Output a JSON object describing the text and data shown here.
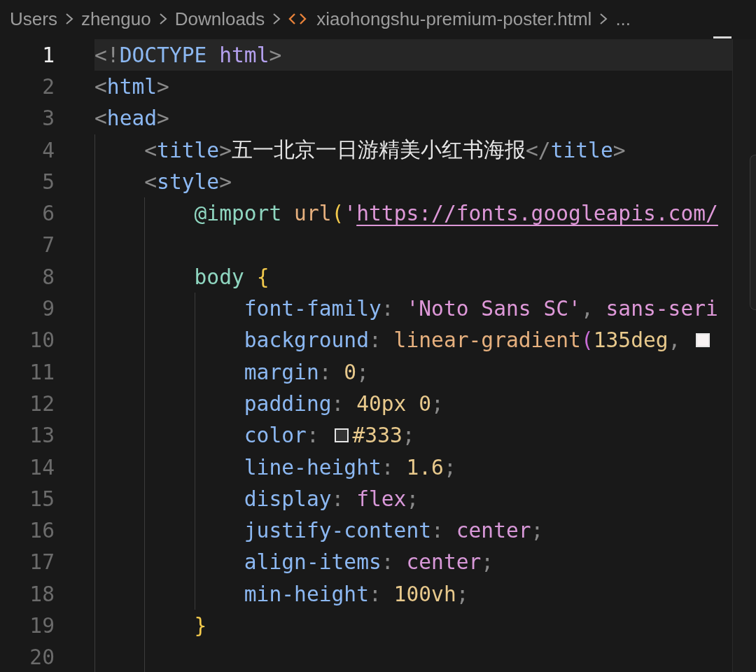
{
  "breadcrumb": {
    "items": [
      {
        "kind": "folder",
        "label": "Users"
      },
      {
        "kind": "folder",
        "label": "zhenguo"
      },
      {
        "kind": "folder",
        "label": "Downloads"
      },
      {
        "kind": "file",
        "label": "xiaohongshu-premium-poster.html"
      }
    ],
    "more": "..."
  },
  "editor": {
    "lines": [
      {
        "number": "1",
        "current": true,
        "tokens": [
          {
            "kind": "punct",
            "text": "<!"
          },
          {
            "kind": "tag",
            "text": "DOCTYPE "
          },
          {
            "kind": "attr",
            "text": "html"
          },
          {
            "kind": "punct",
            "text": ">"
          }
        ]
      },
      {
        "number": "2",
        "current": false,
        "tokens": [
          {
            "kind": "punct",
            "text": "<"
          },
          {
            "kind": "tag",
            "text": "html"
          },
          {
            "kind": "punct",
            "text": ">"
          }
        ]
      },
      {
        "number": "3",
        "current": false,
        "tokens": [
          {
            "kind": "punct",
            "text": "<"
          },
          {
            "kind": "tag",
            "text": "head"
          },
          {
            "kind": "punct",
            "text": ">"
          }
        ]
      },
      {
        "number": "4",
        "current": false,
        "tokens": [
          {
            "kind": "indent"
          },
          {
            "kind": "punct",
            "text": "<"
          },
          {
            "kind": "tag",
            "text": "title"
          },
          {
            "kind": "punct",
            "text": ">"
          },
          {
            "kind": "plain",
            "text": "五一北京一日游精美小红书海报"
          },
          {
            "kind": "punct",
            "text": "</"
          },
          {
            "kind": "tag",
            "text": "title"
          },
          {
            "kind": "punct",
            "text": ">"
          }
        ]
      },
      {
        "number": "5",
        "current": false,
        "tokens": [
          {
            "kind": "indent"
          },
          {
            "kind": "punct",
            "text": "<"
          },
          {
            "kind": "tag",
            "text": "style"
          },
          {
            "kind": "punct",
            "text": ">"
          }
        ]
      },
      {
        "number": "6",
        "current": false,
        "tokens": [
          {
            "kind": "indent"
          },
          {
            "kind": "indent"
          },
          {
            "kind": "atrule",
            "text": "@import "
          },
          {
            "kind": "function",
            "text": "url"
          },
          {
            "kind": "brace",
            "text": "("
          },
          {
            "kind": "string",
            "text": "'"
          },
          {
            "kind": "link",
            "text": "https://fonts.googleapis.com/"
          }
        ]
      },
      {
        "number": "7",
        "current": false,
        "tokens": [
          {
            "kind": "indent"
          },
          {
            "kind": "indent"
          }
        ]
      },
      {
        "number": "8",
        "current": false,
        "tokens": [
          {
            "kind": "indent"
          },
          {
            "kind": "indent"
          },
          {
            "kind": "selector",
            "text": "body "
          },
          {
            "kind": "brace",
            "text": "{"
          }
        ]
      },
      {
        "number": "9",
        "current": false,
        "tokens": [
          {
            "kind": "indent"
          },
          {
            "kind": "indent"
          },
          {
            "kind": "indent"
          },
          {
            "kind": "property",
            "text": "font-family"
          },
          {
            "kind": "punct",
            "text": ": "
          },
          {
            "kind": "string",
            "text": "'Noto Sans SC'"
          },
          {
            "kind": "punct",
            "text": ", "
          },
          {
            "kind": "string",
            "text": "sans-seri"
          }
        ]
      },
      {
        "number": "10",
        "current": false,
        "tokens": [
          {
            "kind": "indent"
          },
          {
            "kind": "indent"
          },
          {
            "kind": "indent"
          },
          {
            "kind": "property",
            "text": "background"
          },
          {
            "kind": "punct",
            "text": ": "
          },
          {
            "kind": "function",
            "text": "linear-gradient"
          },
          {
            "kind": "paren",
            "text": "("
          },
          {
            "kind": "number",
            "text": "135deg"
          },
          {
            "kind": "punct",
            "text": ", "
          },
          {
            "kind": "swatch",
            "color": "#f8f3f3"
          }
        ]
      },
      {
        "number": "11",
        "current": false,
        "tokens": [
          {
            "kind": "indent"
          },
          {
            "kind": "indent"
          },
          {
            "kind": "indent"
          },
          {
            "kind": "property",
            "text": "margin"
          },
          {
            "kind": "punct",
            "text": ": "
          },
          {
            "kind": "number",
            "text": "0"
          },
          {
            "kind": "punct",
            "text": ";"
          }
        ]
      },
      {
        "number": "12",
        "current": false,
        "tokens": [
          {
            "kind": "indent"
          },
          {
            "kind": "indent"
          },
          {
            "kind": "indent"
          },
          {
            "kind": "property",
            "text": "padding"
          },
          {
            "kind": "punct",
            "text": ": "
          },
          {
            "kind": "number",
            "text": "40px 0"
          },
          {
            "kind": "punct",
            "text": ";"
          }
        ]
      },
      {
        "number": "13",
        "current": false,
        "tokens": [
          {
            "kind": "indent"
          },
          {
            "kind": "indent"
          },
          {
            "kind": "indent"
          },
          {
            "kind": "property",
            "text": "color"
          },
          {
            "kind": "punct",
            "text": ": "
          },
          {
            "kind": "swatch",
            "color": "#333333"
          },
          {
            "kind": "number",
            "text": "#333"
          },
          {
            "kind": "punct",
            "text": ";"
          }
        ]
      },
      {
        "number": "14",
        "current": false,
        "tokens": [
          {
            "kind": "indent"
          },
          {
            "kind": "indent"
          },
          {
            "kind": "indent"
          },
          {
            "kind": "property",
            "text": "line-height"
          },
          {
            "kind": "punct",
            "text": ": "
          },
          {
            "kind": "number",
            "text": "1.6"
          },
          {
            "kind": "punct",
            "text": ";"
          }
        ]
      },
      {
        "number": "15",
        "current": false,
        "tokens": [
          {
            "kind": "indent"
          },
          {
            "kind": "indent"
          },
          {
            "kind": "indent"
          },
          {
            "kind": "property",
            "text": "display"
          },
          {
            "kind": "punct",
            "text": ": "
          },
          {
            "kind": "value",
            "text": "flex"
          },
          {
            "kind": "punct",
            "text": ";"
          }
        ]
      },
      {
        "number": "16",
        "current": false,
        "tokens": [
          {
            "kind": "indent"
          },
          {
            "kind": "indent"
          },
          {
            "kind": "indent"
          },
          {
            "kind": "property",
            "text": "justify-content"
          },
          {
            "kind": "punct",
            "text": ": "
          },
          {
            "kind": "value",
            "text": "center"
          },
          {
            "kind": "punct",
            "text": ";"
          }
        ]
      },
      {
        "number": "17",
        "current": false,
        "tokens": [
          {
            "kind": "indent"
          },
          {
            "kind": "indent"
          },
          {
            "kind": "indent"
          },
          {
            "kind": "property",
            "text": "align-items"
          },
          {
            "kind": "punct",
            "text": ": "
          },
          {
            "kind": "value",
            "text": "center"
          },
          {
            "kind": "punct",
            "text": ";"
          }
        ]
      },
      {
        "number": "18",
        "current": false,
        "tokens": [
          {
            "kind": "indent"
          },
          {
            "kind": "indent"
          },
          {
            "kind": "indent"
          },
          {
            "kind": "property",
            "text": "min-height"
          },
          {
            "kind": "punct",
            "text": ": "
          },
          {
            "kind": "number",
            "text": "100vh"
          },
          {
            "kind": "punct",
            "text": ";"
          }
        ]
      },
      {
        "number": "19",
        "current": false,
        "tokens": [
          {
            "kind": "indent"
          },
          {
            "kind": "indent"
          },
          {
            "kind": "brace",
            "text": "}"
          }
        ]
      },
      {
        "number": "20",
        "current": false,
        "tokens": [
          {
            "kind": "indent"
          },
          {
            "kind": "indent"
          }
        ]
      }
    ]
  }
}
